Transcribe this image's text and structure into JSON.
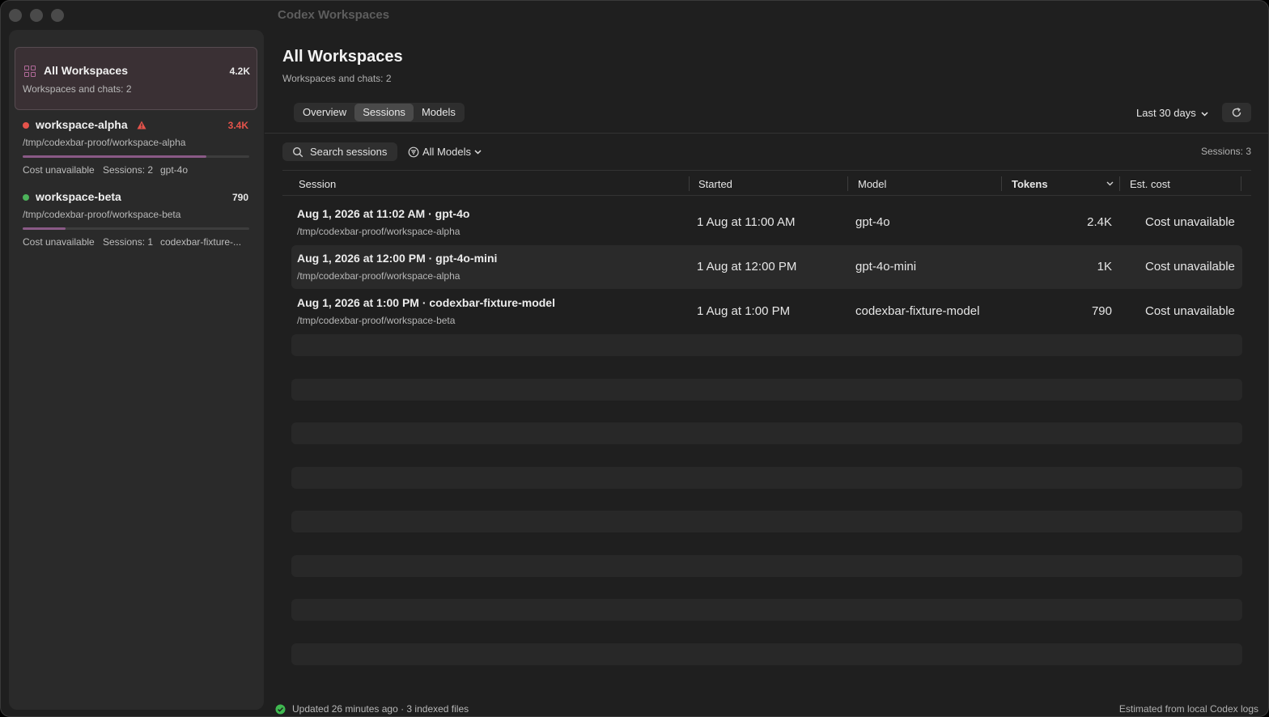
{
  "window": {
    "title": "Codex Workspaces"
  },
  "sidebar": {
    "all": {
      "title": "All Workspaces",
      "count": "4.2K",
      "subtitle": "Workspaces and chats: 2"
    },
    "workspaces": [
      {
        "name": "workspace-alpha",
        "path": "/tmp/codexbar-proof/workspace-alpha",
        "count": "3.4K",
        "cost": "Cost unavailable",
        "sessions": "Sessions: 2",
        "model": "gpt-4o",
        "status_color": "#e5534b",
        "count_color": "#e5534b",
        "usage_fraction": 0.81
      },
      {
        "name": "workspace-beta",
        "path": "/tmp/codexbar-proof/workspace-beta",
        "count": "790",
        "cost": "Cost unavailable",
        "sessions": "Sessions: 1",
        "model": "codexbar-fixture-...",
        "status_color": "#4cb25a",
        "count_color": "#e8e8e8",
        "usage_fraction": 0.19
      }
    ]
  },
  "header": {
    "title": "All Workspaces",
    "subtitle": "Workspaces and chats: 2"
  },
  "tabs": [
    {
      "label": "Overview",
      "active": false
    },
    {
      "label": "Sessions",
      "active": true
    },
    {
      "label": "Models",
      "active": false
    }
  ],
  "range": {
    "label": "Last 30 days"
  },
  "toolbar": {
    "search_label": "Search sessions",
    "filter_label": "All Models",
    "sessions_count": "Sessions: 3"
  },
  "table": {
    "columns": [
      "Session",
      "Started",
      "Model",
      "Tokens",
      "Est. cost"
    ],
    "rows": [
      {
        "title": "Aug 1, 2026 at 11:02 AM · gpt-4o",
        "path": "/tmp/codexbar-proof/workspace-alpha",
        "started": "1 Aug at 11:00 AM",
        "model": "gpt-4o",
        "tokens": "2.4K",
        "cost": "Cost unavailable"
      },
      {
        "title": "Aug 1, 2026 at 12:00 PM · gpt-4o-mini",
        "path": "/tmp/codexbar-proof/workspace-alpha",
        "started": "1 Aug at 12:00 PM",
        "model": "gpt-4o-mini",
        "tokens": "1K",
        "cost": "Cost unavailable"
      },
      {
        "title": "Aug 1, 2026 at 1:00 PM · codexbar-fixture-model",
        "path": "/tmp/codexbar-proof/workspace-beta",
        "started": "1 Aug at 1:00 PM",
        "model": "codexbar-fixture-model",
        "tokens": "790",
        "cost": "Cost unavailable"
      }
    ]
  },
  "footer": {
    "status": "Updated 26 minutes ago · 3 indexed files",
    "right": "Estimated from local Codex logs",
    "status_color": "#3fb950"
  },
  "colors": {
    "accent": "#8a5a86",
    "background": "#1f1f1f",
    "sidebar": "#2a2a2a"
  }
}
